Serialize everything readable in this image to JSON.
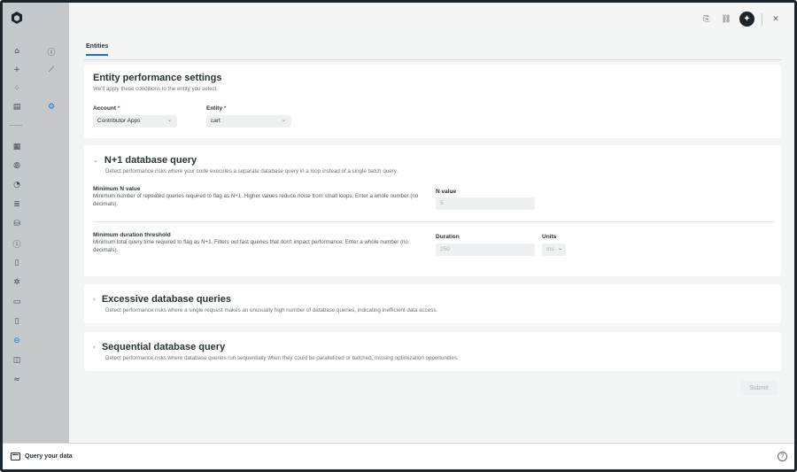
{
  "top_bar": {
    "icons": [
      "feedback-icon",
      "link-icon",
      "ai-assistant-icon",
      "close-icon"
    ]
  },
  "tabs": [
    {
      "label": "Entities",
      "active": true
    }
  ],
  "settings": {
    "title": "Entity performance settings",
    "description": "We'll apply these conditions to the entity you select.",
    "account": {
      "label": "Account",
      "required_mark": "*",
      "value": "Contributor Apps"
    },
    "entity": {
      "label": "Entity",
      "required_mark": "*",
      "value": "cart"
    }
  },
  "n_plus_one": {
    "title": "N+1 database query",
    "description": "Detect performance risks where your code executes a separate database query in a loop instead of a single batch query.",
    "expanded": true,
    "min_n": {
      "title": "Minimum N value",
      "description": "Minimum number of repeated queries required to flag as N+1. Higher values reduce noise from small loops. Enter a whole number (no decimals).",
      "input_label": "N value",
      "placeholder": "5"
    },
    "min_duration": {
      "title": "Minimum duration threshold",
      "description": "Minimum total query time required to flag as N+1. Filters out fast queries that don't impact performance. Enter a whole number (no decimals).",
      "duration_label": "Duration",
      "duration_placeholder": "250",
      "units_label": "Units",
      "units_value": "ms"
    }
  },
  "excessive": {
    "title": "Excessive database queries",
    "description": "Detect performance risks where a single request makes an unusually high number of database queries, indicating inefficient data access.",
    "expanded": false
  },
  "sequential": {
    "title": "Sequential database query",
    "description": "Detect performance risks where database queries run sequentially when they could be parallelized or batched, missing optimization opportunities.",
    "expanded": false
  },
  "submit_label": "Submit",
  "bottom_bar": {
    "query_label": "Query your data",
    "help_icon": "help-icon"
  },
  "colors": {
    "accent": "#0c74df",
    "rail": "#c6c9cb",
    "required": "#df2d24"
  }
}
